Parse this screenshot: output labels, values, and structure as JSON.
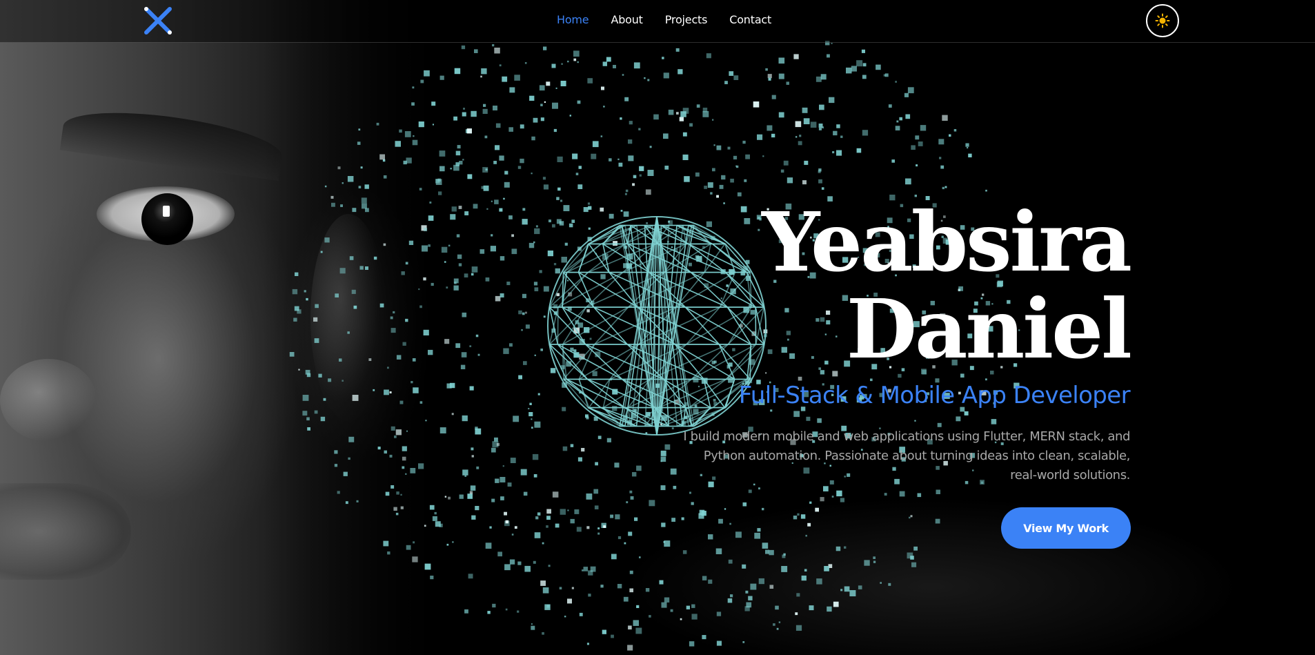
{
  "nav": {
    "logo_icon": "x-logo-icon",
    "links": [
      {
        "label": "Home",
        "active": true
      },
      {
        "label": "About",
        "active": false
      },
      {
        "label": "Projects",
        "active": false
      },
      {
        "label": "Contact",
        "active": false
      }
    ],
    "theme_toggle_icon": "sun-icon"
  },
  "hero": {
    "name_line1": "Yeabsira",
    "name_line2": "Daniel",
    "subtitle": "Full-Stack & Mobile App Developer",
    "description": "I build modern mobile and web applications using Flutter, MERN stack, and Python automation. Passionate about turning ideas into clean, scalable, real-world solutions.",
    "cta_label": "View My Work"
  },
  "colors": {
    "accent": "#3b82f6",
    "particles": "#7fd1d1",
    "sun": "#f5b400",
    "background": "#000000"
  }
}
